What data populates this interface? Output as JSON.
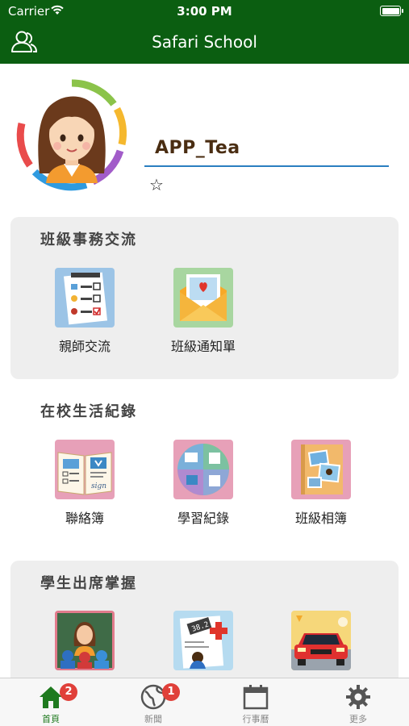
{
  "status_bar": {
    "carrier": "Carrier",
    "time": "3:00 PM"
  },
  "header": {
    "title": "Safari School",
    "left_icon": "contacts-icon"
  },
  "profile": {
    "username": "APP_Tea",
    "favorite_icon": "star-outline-icon"
  },
  "sections": [
    {
      "title": "班級事務交流",
      "items": [
        {
          "label": "親師交流",
          "icon": "checklist-icon"
        },
        {
          "label": "班級通知單",
          "icon": "envelope-heart-icon"
        }
      ]
    },
    {
      "title": "在校生活紀錄",
      "items": [
        {
          "label": "聯絡簿",
          "icon": "notebook-icon"
        },
        {
          "label": "學習紀錄",
          "icon": "learning-record-icon"
        },
        {
          "label": "班級相簿",
          "icon": "photo-album-icon"
        }
      ]
    },
    {
      "title": "學生出席掌握",
      "items": [
        {
          "label": "",
          "icon": "classroom-teacher-icon"
        },
        {
          "label": "",
          "icon": "temperature-record-icon"
        },
        {
          "label": "",
          "icon": "pickup-car-icon"
        }
      ]
    }
  ],
  "tabbar": [
    {
      "label": "首頁",
      "icon": "home-icon",
      "badge": "2",
      "active": true
    },
    {
      "label": "新聞",
      "icon": "globe-icon",
      "badge": "1",
      "active": false
    },
    {
      "label": "行事曆",
      "icon": "calendar-icon",
      "badge": "",
      "active": false
    },
    {
      "label": "更多",
      "icon": "gear-icon",
      "badge": "",
      "active": false
    }
  ],
  "colors": {
    "header_bg": "#0b5e11",
    "accent_underline": "#2a7fc0",
    "badge": "#e0403a",
    "active_tab": "#1f7a1f"
  }
}
